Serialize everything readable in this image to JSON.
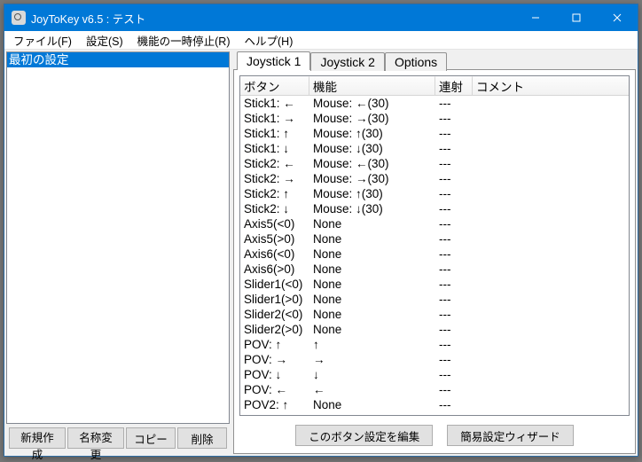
{
  "title": "JoyToKey v6.5 : テスト",
  "menu": {
    "file": "ファイル(F)",
    "settings": "設定(S)",
    "pause": "機能の一時停止(R)",
    "help": "ヘルプ(H)"
  },
  "profiles": {
    "items": [
      "最初の設定"
    ],
    "selected": 0
  },
  "profile_buttons": {
    "new": "新規作成",
    "rename": "名称変更",
    "copy": "コピー",
    "delete": "削除"
  },
  "tabs": [
    "Joystick 1",
    "Joystick 2",
    "Options"
  ],
  "columns": {
    "button": "ボタン",
    "function": "機能",
    "repeat": "連射",
    "comment": "コメント"
  },
  "rows": [
    {
      "b": "Stick1: ←",
      "f": "Mouse: ←(30)",
      "r": "---"
    },
    {
      "b": "Stick1: →",
      "f": "Mouse: →(30)",
      "r": "---"
    },
    {
      "b": "Stick1: ↑",
      "f": "Mouse: ↑(30)",
      "r": "---"
    },
    {
      "b": "Stick1: ↓",
      "f": "Mouse: ↓(30)",
      "r": "---"
    },
    {
      "b": "Stick2: ←",
      "f": "Mouse: ←(30)",
      "r": "---"
    },
    {
      "b": "Stick2: →",
      "f": "Mouse: →(30)",
      "r": "---"
    },
    {
      "b": "Stick2: ↑",
      "f": "Mouse: ↑(30)",
      "r": "---"
    },
    {
      "b": "Stick2: ↓",
      "f": "Mouse: ↓(30)",
      "r": "---"
    },
    {
      "b": "Axis5(<0)",
      "f": "None",
      "r": "---"
    },
    {
      "b": "Axis5(>0)",
      "f": "None",
      "r": "---"
    },
    {
      "b": "Axis6(<0)",
      "f": "None",
      "r": "---"
    },
    {
      "b": "Axis6(>0)",
      "f": "None",
      "r": "---"
    },
    {
      "b": "Slider1(<0)",
      "f": "None",
      "r": "---"
    },
    {
      "b": "Slider1(>0)",
      "f": "None",
      "r": "---"
    },
    {
      "b": "Slider2(<0)",
      "f": "None",
      "r": "---"
    },
    {
      "b": "Slider2(>0)",
      "f": "None",
      "r": "---"
    },
    {
      "b": "POV: ↑",
      "f": "↑",
      "r": "---"
    },
    {
      "b": "POV: →",
      "f": "→",
      "r": "---"
    },
    {
      "b": "POV: ↓",
      "f": "↓",
      "r": "---"
    },
    {
      "b": "POV: ←",
      "f": "←",
      "r": "---"
    },
    {
      "b": "POV2: ↑",
      "f": "None",
      "r": "---"
    }
  ],
  "right_buttons": {
    "edit": "このボタン設定を編集",
    "wizard": "簡易設定ウィザード"
  }
}
